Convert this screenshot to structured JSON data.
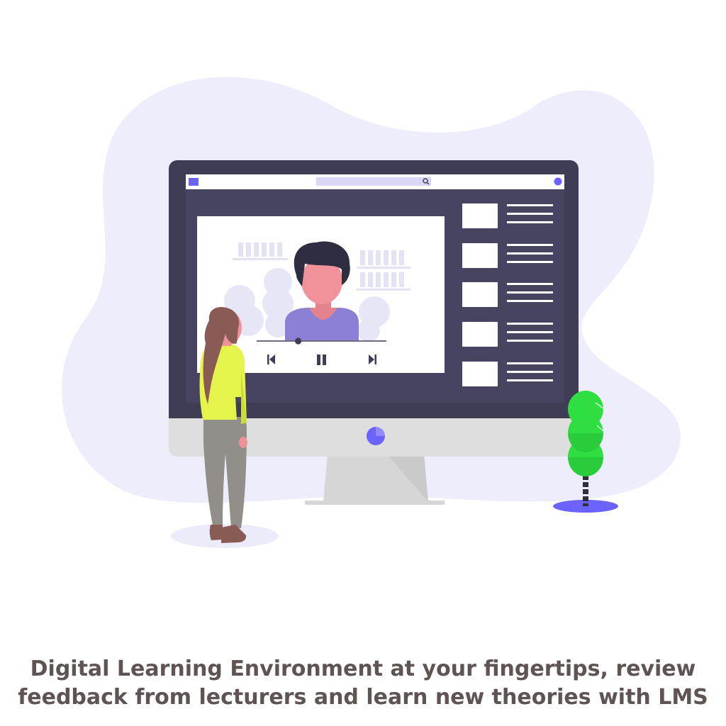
{
  "caption": {
    "line1": "Digital Learning Environment at your fingertips, review",
    "line2": "feedback from lecturers and learn new theories with LMS"
  },
  "video": {
    "progress": 0.32
  },
  "sidebar": {
    "items": [
      "thumbnail",
      "thumbnail",
      "thumbnail",
      "thumbnail",
      "thumbnail"
    ]
  },
  "icons": {
    "search": "search-icon",
    "previous": "skip-previous-icon",
    "pause": "pause-icon",
    "next": "skip-next-icon"
  },
  "colors": {
    "blob": "#eeedfb",
    "monitor_bezel": "#3f3d56",
    "monitor_screen": "#474462",
    "accent": "#6c63ff",
    "stand": "#d6d6d6",
    "plant": "#2fde40",
    "caption_text": "#5e5453"
  }
}
